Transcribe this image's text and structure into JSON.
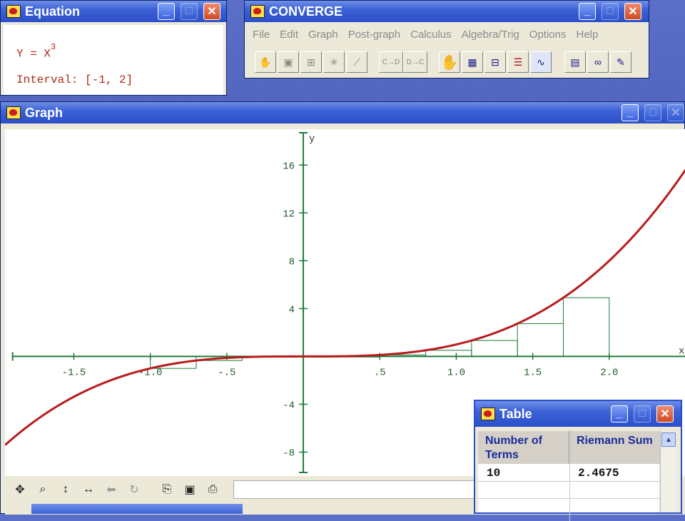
{
  "equation_window": {
    "title": "Equation",
    "equation_lhs": "Y = X",
    "equation_exp": "3",
    "interval": "Interval: [-1, 2]"
  },
  "converge_window": {
    "title": "CONVERGE",
    "menu": [
      "File",
      "Edit",
      "Graph",
      "Post-graph",
      "Calculus",
      "Algebra/Trig",
      "Options",
      "Help"
    ],
    "toolbar_labels": [
      "C→D",
      "D→C"
    ]
  },
  "graph_window": {
    "title": "Graph",
    "x_axis_label": "x",
    "y_axis_label": "y",
    "x_ticks": [
      "-1.5",
      "-1.0",
      "-.5",
      ".5",
      "1.0",
      "1.5",
      "2.0"
    ],
    "y_ticks": [
      "16",
      "12",
      "8",
      "4",
      "-4",
      "-8"
    ]
  },
  "table_window": {
    "title": "Table",
    "col1_header": "Number of Terms",
    "col2_header": "Riemann Sum",
    "rows": [
      {
        "terms": "10",
        "sum": "2.4675"
      }
    ]
  },
  "colors": {
    "curve": "#b81c1c",
    "axes": "#1f7a3a",
    "rect": "#1f7a3a",
    "titlebar": "#2a4fc8"
  },
  "chart_data": {
    "type": "line",
    "title": "",
    "xlabel": "x",
    "ylabel": "y",
    "function": "y = x^3",
    "xlim": [
      -1.95,
      2.5
    ],
    "ylim": [
      -10,
      19
    ],
    "x_ticks": [
      -1.5,
      -1.0,
      -0.5,
      0.5,
      1.0,
      1.5,
      2.0
    ],
    "y_ticks": [
      -8,
      -4,
      4,
      8,
      12,
      16
    ],
    "series": [],
    "riemann": {
      "interval": [
        -1,
        2
      ],
      "n": 10,
      "method": "left",
      "sum": 2.4675
    }
  }
}
